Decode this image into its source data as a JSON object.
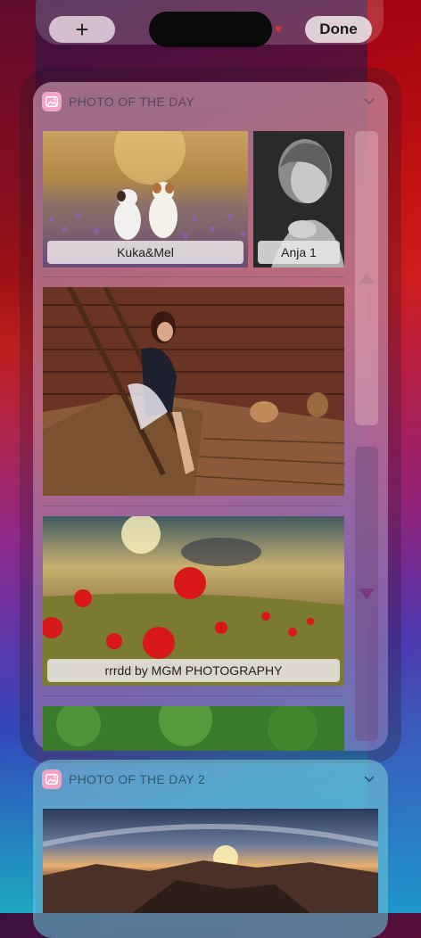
{
  "topbar": {
    "add_label": "+",
    "done_label": "Done"
  },
  "widgets": [
    {
      "title": "PHOTO OF THE DAY",
      "photos": [
        {
          "caption": "Kuka&Mel",
          "subject": "two dogs in lavender field"
        },
        {
          "caption": "Anja 1",
          "subject": "black and white portrait"
        },
        {
          "caption": "",
          "subject": "woman sitting on ladder in barn"
        },
        {
          "caption": "rrrdd by MGM PHOTOGRAPHY",
          "subject": "poppies at sunset"
        },
        {
          "caption": "",
          "subject": "green forest"
        }
      ]
    },
    {
      "title": "PHOTO OF THE DAY 2",
      "photos": [
        {
          "caption": "",
          "subject": "mountain panorama at sunset"
        }
      ]
    }
  ],
  "colors": {
    "app_icon": "#f1a6c8",
    "down_arrow": "#7a3a7a"
  }
}
